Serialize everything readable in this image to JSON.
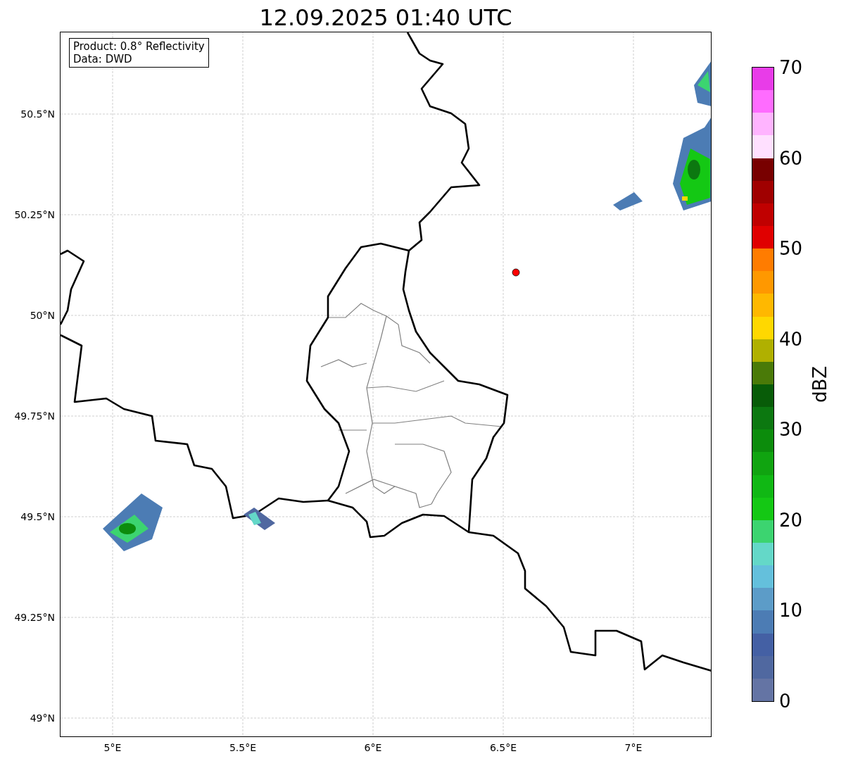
{
  "title": "12.09.2025 01:40 UTC",
  "map": {
    "info_lines": [
      "Product: 0.8° Reflectivity",
      "Data: DWD"
    ],
    "xticks": [
      "5°E",
      "5.5°E",
      "6°E",
      "6.5°E",
      "7°E"
    ],
    "yticks": [
      "50.5°N",
      "50.25°N",
      "50°N",
      "49.75°N",
      "49.5°N",
      "49.25°N",
      "49°N"
    ]
  },
  "colorbar": {
    "label": "dBZ",
    "ticks": [
      "70",
      "60",
      "50",
      "40",
      "30",
      "20",
      "10",
      "0"
    ],
    "bins": [
      {
        "color": "#6474a4"
      },
      {
        "color": "#5068a0"
      },
      {
        "color": "#4460a4"
      },
      {
        "color": "#4c7cb4"
      },
      {
        "color": "#5c9cc8"
      },
      {
        "color": "#64c0dc"
      },
      {
        "color": "#64d8c8"
      },
      {
        "color": "#3cd470"
      },
      {
        "color": "#14c814"
      },
      {
        "color": "#10b814"
      },
      {
        "color": "#10a410"
      },
      {
        "color": "#0c8c0c"
      },
      {
        "color": "#0c7810"
      },
      {
        "color": "#085c08"
      },
      {
        "color": "#4a7a08"
      },
      {
        "color": "#b0b000"
      },
      {
        "color": "#ffd800"
      },
      {
        "color": "#ffb800"
      },
      {
        "color": "#ff9800"
      },
      {
        "color": "#ff7c00"
      },
      {
        "color": "#e00000"
      },
      {
        "color": "#c00000"
      },
      {
        "color": "#a00000"
      },
      {
        "color": "#780000"
      },
      {
        "color": "#ffe0ff"
      },
      {
        "color": "#ffb4ff"
      },
      {
        "color": "#ff6cff"
      },
      {
        "color": "#e83ce8"
      }
    ]
  }
}
